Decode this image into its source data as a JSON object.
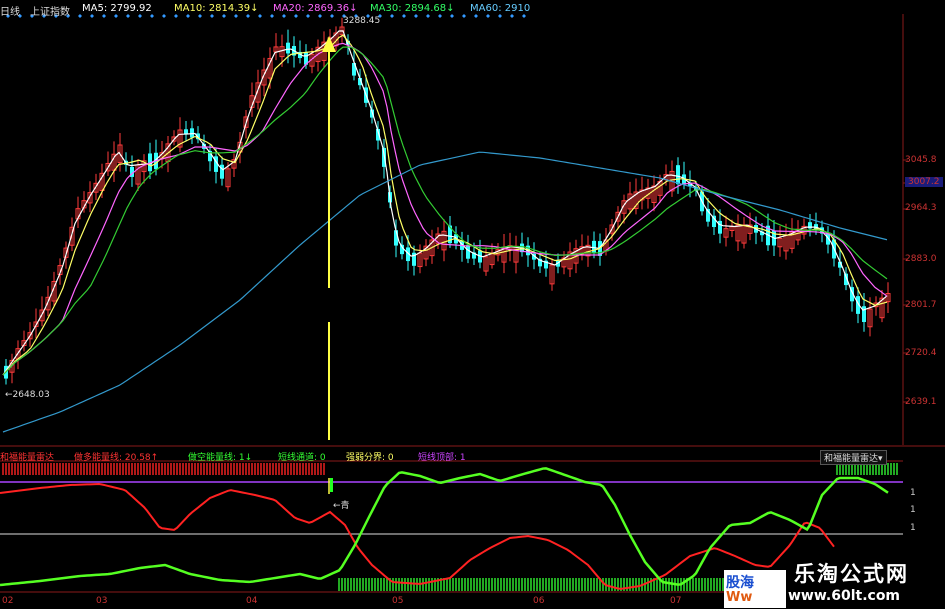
{
  "header": {
    "period": "日线",
    "index_name": "上证指数",
    "ma5": {
      "label": "MA5:",
      "value": "2799.92",
      "color": "#ffffff"
    },
    "ma10": {
      "label": "MA10:",
      "value": "2814.39",
      "arrow": "↓",
      "color": "#ffff66"
    },
    "ma20": {
      "label": "MA20:",
      "value": "2869.36",
      "arrow": "↓",
      "color": "#ff66ff"
    },
    "ma30": {
      "label": "MA30:",
      "value": "2894.68",
      "arrow": "↓",
      "color": "#33ff66"
    },
    "ma60": {
      "label": "MA60:",
      "value": "2910",
      "color": "#66ccff"
    }
  },
  "price_axis": [
    {
      "label": "3045.8"
    },
    {
      "label": "3007.2",
      "highlight": true
    },
    {
      "label": "2964.3"
    },
    {
      "label": "2883.0"
    },
    {
      "label": "2801.7"
    },
    {
      "label": "2720.4"
    },
    {
      "label": "2639.1"
    }
  ],
  "annotations": {
    "high": "3288.45",
    "low": "←2648.03",
    "signal": "←青"
  },
  "indicator_header": {
    "name": "和福能量雷达",
    "items": [
      {
        "text": "做多能量线: 20.58",
        "arrow": "↑",
        "color": "#ff3333"
      },
      {
        "text": "做空能量线: 1",
        "arrow": "↓",
        "color": "#33ff33"
      },
      {
        "text": "短线通道: 0",
        "color": "#33ff33"
      },
      {
        "text": "强弱分界: 0",
        "color": "#ffff66"
      },
      {
        "text": "短线顶部: 1",
        "color": "#cc44ff"
      }
    ],
    "selector": "和福能量雷达▾"
  },
  "indicator_axis": [
    "1",
    "1",
    "1"
  ],
  "x_axis": [
    "02",
    "03",
    "04",
    "05",
    "06",
    "07"
  ],
  "watermark": {
    "title": "乐淘公式网",
    "url": "www.60lt.com",
    "logo_top": "股海",
    "logo_bottom": "Ww"
  },
  "colors": {
    "up": "#ff3b3b",
    "down": "#33ffff",
    "ma5": "#ffffff",
    "ma10": "#ffff66",
    "ma20": "#ff66ff",
    "ma30": "#33cc33",
    "ma60": "#3399cc",
    "long_energy": "#ff2222",
    "short_energy": "#55ff22",
    "signal_line": "#ffff44",
    "top_line": "#aa44ff"
  }
}
